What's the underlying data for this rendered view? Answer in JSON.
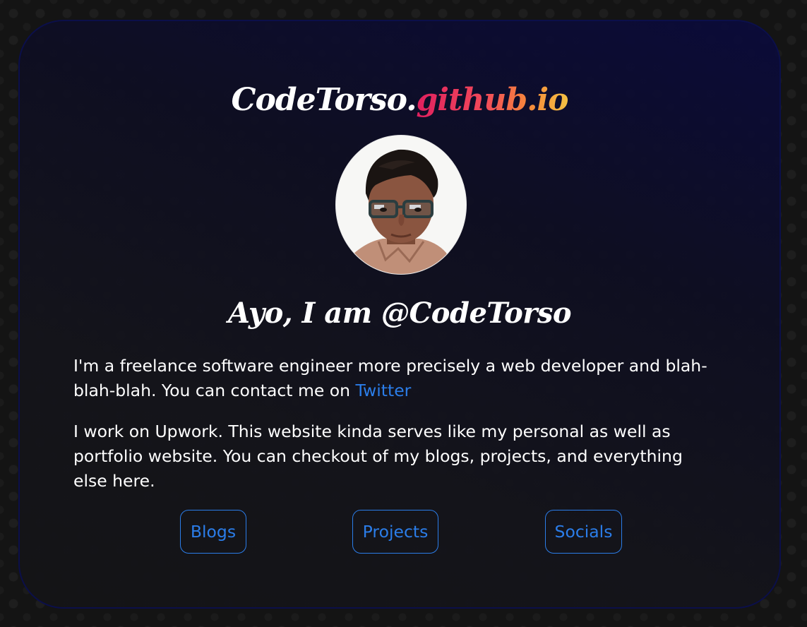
{
  "header": {
    "title_main": "CodeTorso.",
    "title_accent": "github.io"
  },
  "hero": {
    "greeting": "Ayo, I am @CodeTorso",
    "avatar_icon": "profile-photo"
  },
  "about": {
    "para1_text": "I'm a freelance software engineer more precisely a web developer and blah-blah-blah. You can contact me on ",
    "para1_link": "Twitter",
    "para2_text": "I work on Upwork. This website kinda serves like my personal as well as portfolio website. You can checkout of my blogs, projects, and everything else here."
  },
  "nav": {
    "blogs_label": "Blogs",
    "projects_label": "Projects",
    "socials_label": "Socials"
  },
  "colors": {
    "background": "#141414",
    "card_border": "#0b0f4a",
    "accent_link": "#2b7de9",
    "title_gradient": [
      "#e0205f",
      "#f68a3a",
      "#f4c043"
    ]
  }
}
